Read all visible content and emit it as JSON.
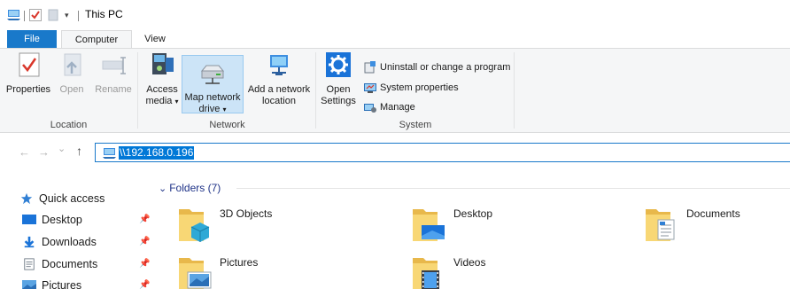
{
  "window": {
    "title": "This PC"
  },
  "quick_access_toolbar": {
    "icons": [
      "this-pc-icon",
      "properties-check-icon",
      "new-folder-icon",
      "customize-arrow-icon"
    ],
    "dropdown_glyph": "▾"
  },
  "tabs": [
    {
      "label": "File",
      "active": false
    },
    {
      "label": "Computer",
      "active": true
    },
    {
      "label": "View",
      "active": false
    }
  ],
  "ribbon": {
    "location": {
      "label": "Location",
      "buttons": [
        {
          "label": "Properties",
          "icon": "properties-icon",
          "enabled": true
        },
        {
          "label": "Open",
          "icon": "open-icon",
          "enabled": false
        },
        {
          "label": "Rename",
          "icon": "rename-icon",
          "enabled": false
        }
      ]
    },
    "network": {
      "label": "Network",
      "buttons": [
        {
          "line1": "Access",
          "line2": "media",
          "caret": "▾",
          "icon": "access-media-icon"
        },
        {
          "line1": "Map network",
          "line2": "drive",
          "caret": "▾",
          "icon": "map-drive-icon",
          "active": true
        },
        {
          "line1": "Add a network",
          "line2": "location",
          "caret": "",
          "icon": "add-network-location-icon"
        }
      ]
    },
    "system": {
      "label": "System",
      "open_settings": {
        "line1": "Open",
        "line2": "Settings",
        "icon": "settings-gear-icon"
      },
      "small_buttons": [
        {
          "label": "Uninstall or change a program",
          "icon": "uninstall-icon"
        },
        {
          "label": "System properties",
          "icon": "system-properties-icon"
        },
        {
          "label": "Manage",
          "icon": "manage-icon"
        }
      ]
    }
  },
  "navigation": {
    "back_glyph": "←",
    "forward_glyph": "→",
    "recent_glyph": "⌄",
    "up_glyph": "↑",
    "address": "\\\\192.168.0.196"
  },
  "nav_pane": {
    "quick_access_label": "Quick access",
    "items": [
      {
        "label": "Desktop",
        "icon": "desktop-icon",
        "pinned": true
      },
      {
        "label": "Downloads",
        "icon": "downloads-icon",
        "pinned": true
      },
      {
        "label": "Documents",
        "icon": "documents-icon",
        "pinned": true
      },
      {
        "label": "Pictures",
        "icon": "pictures-icon",
        "pinned": true
      }
    ],
    "pin_glyph": "📌"
  },
  "content": {
    "section_title": "Folders (7)",
    "collapse_glyph": "⌄",
    "folders": [
      {
        "name": "3D Objects",
        "icon": "3d-objects-folder-icon"
      },
      {
        "name": "Desktop",
        "icon": "desktop-folder-icon"
      },
      {
        "name": "Documents",
        "icon": "documents-folder-icon"
      },
      {
        "name": "Pictures",
        "icon": "pictures-folder-icon"
      },
      {
        "name": "Videos",
        "icon": "videos-folder-icon"
      }
    ]
  },
  "colors": {
    "accent": "#1979ca",
    "selection": "#0078d7",
    "folder_yellow": "#f8d775",
    "ribbon_bg": "#f5f6f7"
  }
}
